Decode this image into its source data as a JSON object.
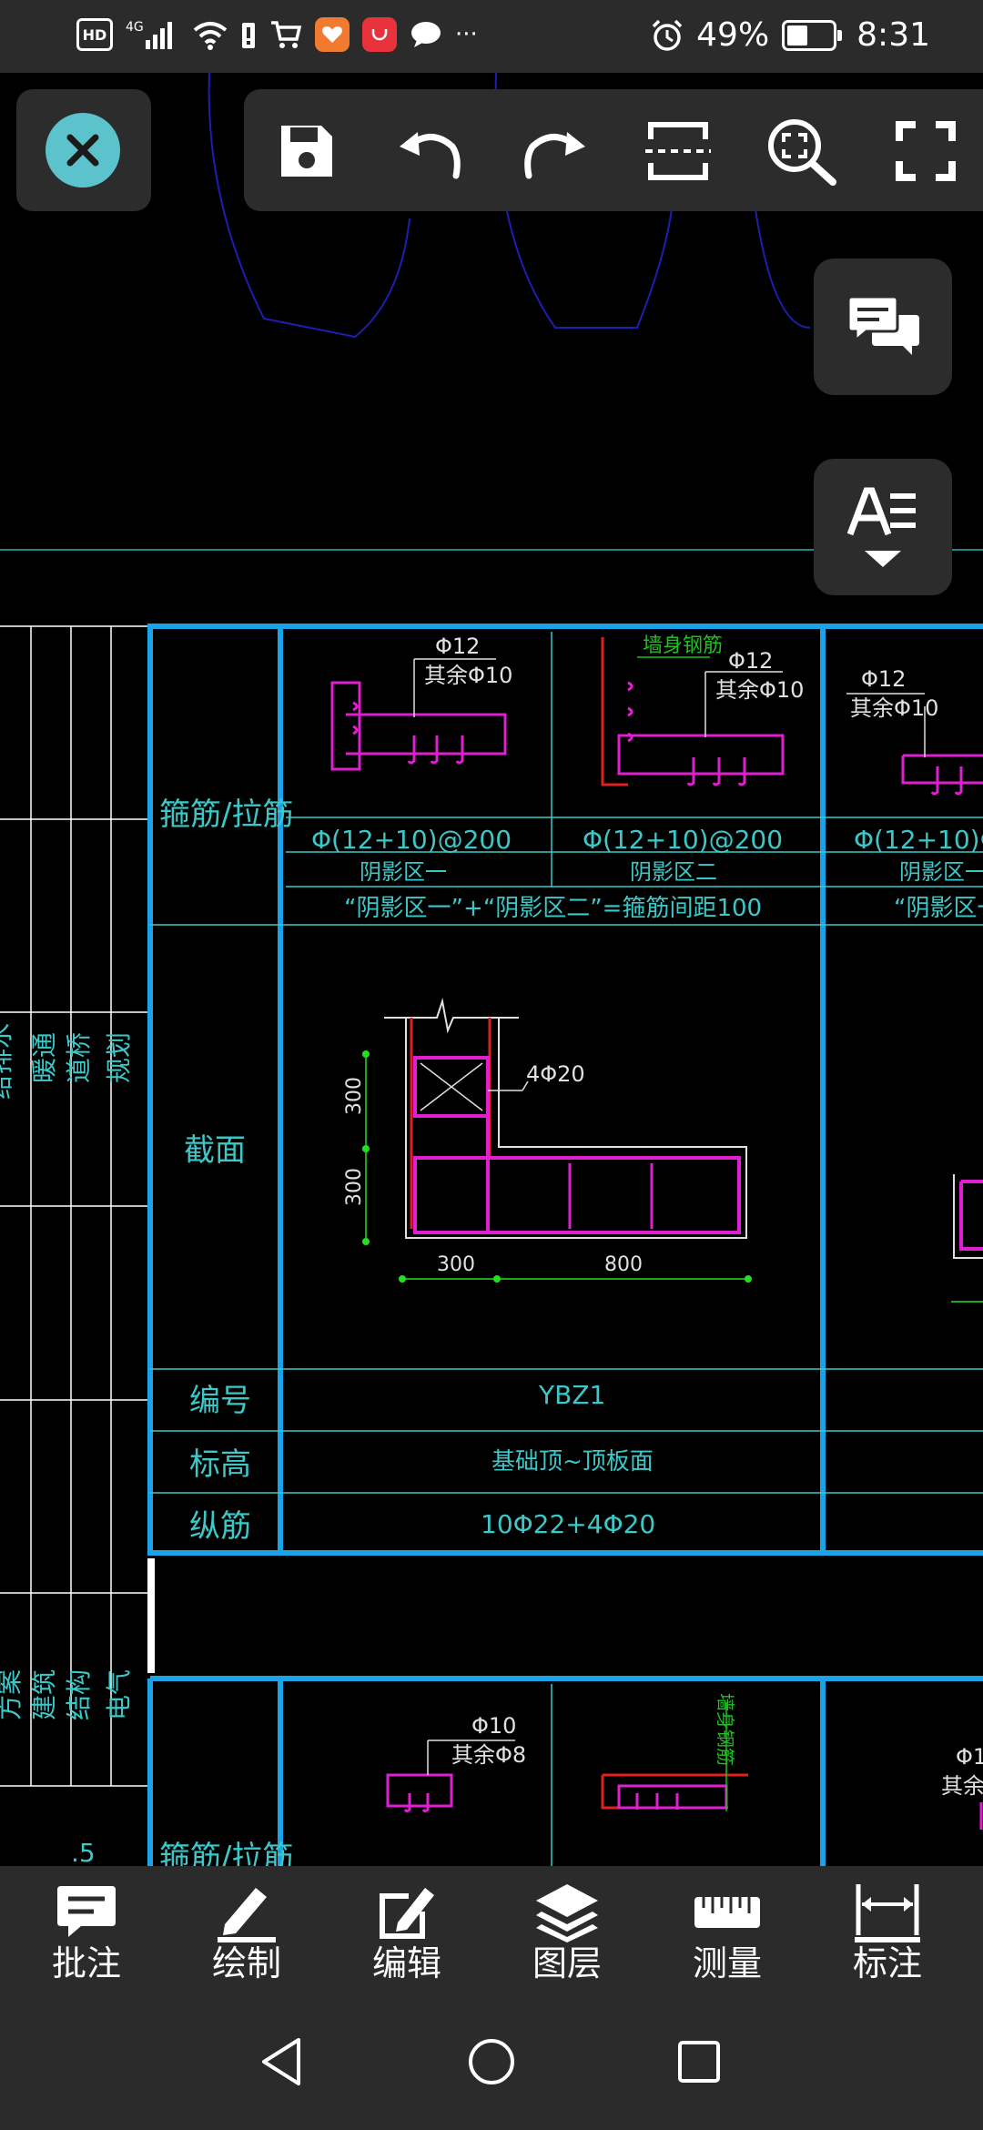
{
  "status_bar": {
    "left_badges": [
      "HD",
      "4G"
    ],
    "battery_percent": "49%",
    "time": "8:31",
    "more_indicator": "···"
  },
  "toolbar": {
    "icons": [
      "save-icon",
      "undo-icon",
      "redo-icon",
      "section-icon",
      "zoom-region-icon",
      "fullscreen-icon"
    ]
  },
  "side_buttons": {
    "comments": "comments-icon",
    "text_style": "text-style-icon"
  },
  "drawing": {
    "row_labels": {
      "stirrup": "箍筋/拉筋",
      "section": "截面",
      "code": "编号",
      "elevation": "标高",
      "longitudinal": "纵筋"
    },
    "stirrup_row2": "箍筋/拉筋",
    "col1": {
      "bar_top": "Φ12",
      "bar_other": "其余Φ10",
      "spec": "Φ(12+10)@200",
      "zone": "阴影区一"
    },
    "col2": {
      "wall_bar": "墙身钢筋",
      "bar_top": "Φ12",
      "bar_other": "其余Φ10",
      "spec": "Φ(12+10)@200",
      "zone": "阴影区二"
    },
    "col3": {
      "bar_top": "Φ12",
      "bar_other": "其余Φ10",
      "spec": "Φ(12+10)Ф",
      "zone": "阴影区一",
      "note": "“阴影区一"
    },
    "merged_note": "“阴影区一”+“阴影区二”=箍筋间距100",
    "section": {
      "rebar_label": "4Φ20",
      "dim_v1": "300",
      "dim_v2": "300",
      "dim_h1": "300",
      "dim_h2": "800"
    },
    "code": "YBZ1",
    "elevation": "基础顶~顶板面",
    "longitudinal": "10Φ22+4Φ20",
    "lower_col1": {
      "bar_top": "Φ10",
      "bar_other": "其余Φ8"
    },
    "lower_col2": {
      "wall_bar": "墙身钢筋"
    },
    "lower_col3": {
      "bar_top": "Φ1",
      "bar_other": "其余Φ"
    },
    "left_strip_1": [
      "给排水",
      "暖通",
      "道桥",
      "规划"
    ],
    "left_strip_2": [
      "方案",
      "建筑",
      "结构",
      "电气"
    ],
    "left_strip_num": ".5"
  },
  "bottom_tabs": [
    {
      "label": "批注",
      "icon": "comment-icon"
    },
    {
      "label": "绘制",
      "icon": "pencil-icon"
    },
    {
      "label": "编辑",
      "icon": "edit-icon"
    },
    {
      "label": "图层",
      "icon": "layers-icon"
    },
    {
      "label": "测量",
      "icon": "ruler-icon"
    },
    {
      "label": "标注",
      "icon": "dimension-icon"
    }
  ],
  "colors": {
    "bar_bg": "#2b2b2b",
    "cad_cyan": "#1aa3e8",
    "cad_text": "#3cc8c8",
    "rebar_magenta": "#e020d0",
    "accent_teal": "#5cc3cc"
  }
}
